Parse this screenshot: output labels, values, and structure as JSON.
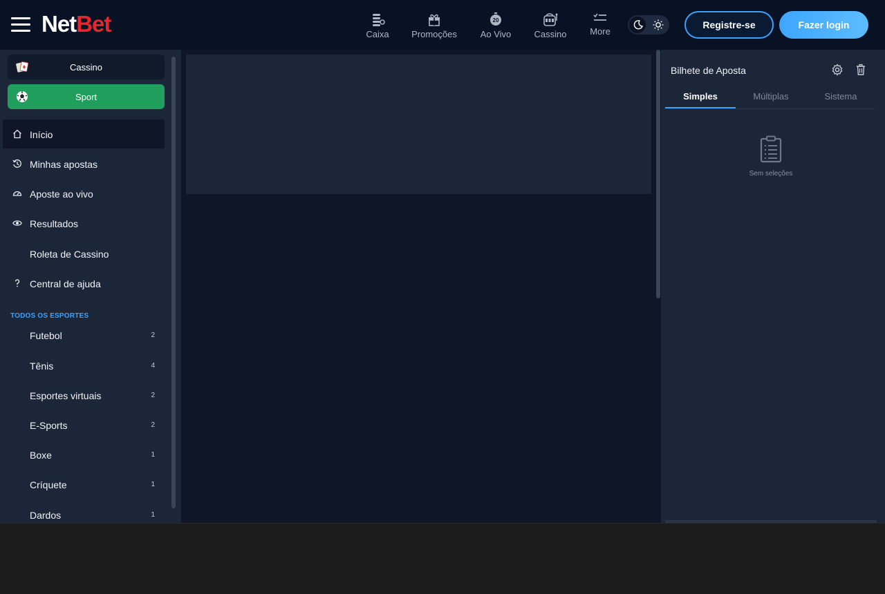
{
  "header": {
    "logo_part1": "Net",
    "logo_part2": "Bet",
    "nav": [
      {
        "label": "Caixa",
        "icon": "coins-stack-icon"
      },
      {
        "label": "Promoções",
        "icon": "gift-icon"
      },
      {
        "label": "Ao Vivo",
        "icon": "stopwatch-icon",
        "badge": "20"
      },
      {
        "label": "Cassino",
        "icon": "slot-machine-icon"
      },
      {
        "label": "More",
        "icon": "more-list-icon"
      }
    ],
    "register_label": "Registre-se",
    "login_label": "Fazer login"
  },
  "sidebar": {
    "switch": [
      {
        "label": "Cassino",
        "icon": "cards-icon"
      },
      {
        "label": "Sport",
        "icon": "soccer-ball-icon"
      }
    ],
    "menu": [
      {
        "label": "Início",
        "icon": "home-icon",
        "active": true
      },
      {
        "label": "Minhas apostas",
        "icon": "history-icon"
      },
      {
        "label": "Aposte ao vivo",
        "icon": "speedometer-icon"
      },
      {
        "label": "Resultados",
        "icon": "eye-icon"
      },
      {
        "label": "Roleta de Cassino",
        "icon": ""
      },
      {
        "label": "Central de ajuda",
        "icon": "help-icon"
      }
    ],
    "sports_title": "TODOS OS ESPORTES",
    "sports": [
      {
        "label": "Futebol",
        "count": "2"
      },
      {
        "label": "Tênis",
        "count": "4"
      },
      {
        "label": "Esportes virtuais",
        "count": "2"
      },
      {
        "label": "E-Sports",
        "count": "2"
      },
      {
        "label": "Boxe",
        "count": "1"
      },
      {
        "label": "Críquete",
        "count": "1"
      },
      {
        "label": "Dardos",
        "count": "1"
      }
    ]
  },
  "betslip": {
    "title": "Bilhete de Aposta",
    "tabs": [
      "Simples",
      "Múltiplas",
      "Sistema"
    ],
    "empty_text": "Sem seleções"
  },
  "colors": {
    "brand_red": "#e8242f",
    "accent_blue": "#3ba3ff",
    "sport_green": "#1f9e5c",
    "background": "#0e1628",
    "panel": "#1b2638"
  }
}
